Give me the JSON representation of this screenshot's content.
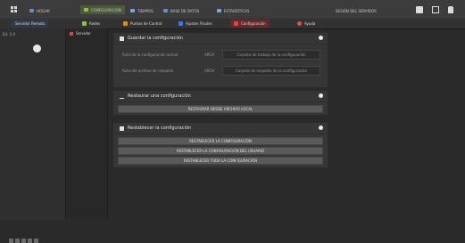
{
  "topbar": {
    "nav": [
      {
        "label": "HOGAR",
        "color": "#5b8fd6"
      },
      {
        "label": "CONFIGURACIÓN",
        "color": "#8cbf4f"
      },
      {
        "label": "TIEMPOS",
        "color": "#7aa7e0"
      },
      {
        "label": "BASE DE DATOS",
        "color": "#5b8fd6"
      },
      {
        "label": "ESTADÍSTICAS",
        "color": "#7aa7e0"
      }
    ],
    "right_label": "SESIÓN DEL SERVIDOR"
  },
  "subtabs": [
    {
      "label": "Servidor Remoto",
      "color": "#3e7bd6"
    },
    {
      "label": "Redes",
      "color": "#8cbf4f"
    },
    {
      "label": "Puntos de Control",
      "color": "#e08a2a"
    },
    {
      "label": "Ajustes Finales",
      "color": "#3e7bd6"
    },
    {
      "label": "Configuración",
      "color": "#d84646"
    },
    {
      "label": "Ayuda",
      "color": "#e05050"
    }
  ],
  "sidebar": {
    "title": "Ed. 1.0"
  },
  "leftcol2": {
    "label": "Servidor"
  },
  "panel_save": {
    "title": "Guardar la configuración",
    "rows": [
      {
        "label": "Ruta de la configuración actual",
        "unit": "ARCH",
        "value": "Carpeta de trabajo de la configuración"
      },
      {
        "label": "Ruta del archivo de respaldo",
        "unit": "ARCH",
        "value": "Carpeta de respaldo de la configuración"
      }
    ]
  },
  "panel_restore": {
    "title": "Restaurar una configuración",
    "button": "RESTAURAR DESDE ARCHIVO LOCAL"
  },
  "panel_reset": {
    "title": "Restablecer la configuración",
    "buttons": [
      "RESTABLECER LA CONFIGURACIÓN",
      "RESTABLECER LA CONFIGURACIÓN DEL USUARIO",
      "RESTABLECER TODA LA CONFIGURACIÓN"
    ]
  }
}
